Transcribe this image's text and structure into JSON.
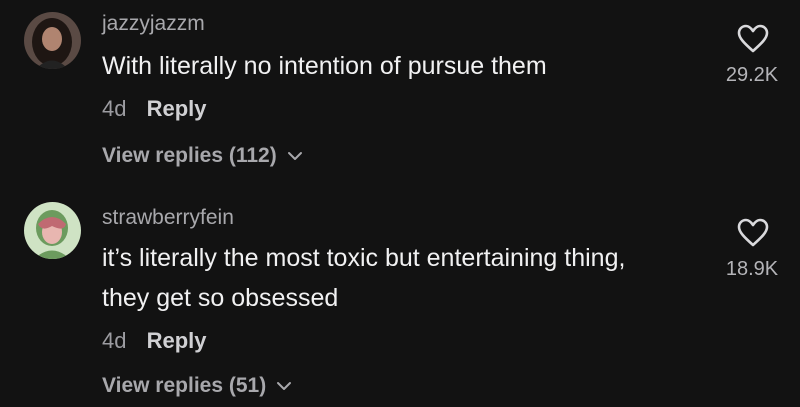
{
  "comments": [
    {
      "username": "jazzyjazzm",
      "text": "With literally no intention of pursue them",
      "time": "4d",
      "reply_label": "Reply",
      "view_replies": "View replies (112)",
      "likes": "29.2K",
      "avatar_icon": "profile-photo"
    },
    {
      "username": "strawberryfein",
      "text": "it’s literally the most toxic but entertaining thing, they get so obsessed",
      "time": "4d",
      "reply_label": "Reply",
      "view_replies": "View replies (51)",
      "likes": "18.9K",
      "avatar_icon": "anime-girl-avatar"
    }
  ],
  "colors": {
    "background": "#121212",
    "primary_text": "#f1f1f2",
    "secondary_text": "#a8a8ac"
  }
}
